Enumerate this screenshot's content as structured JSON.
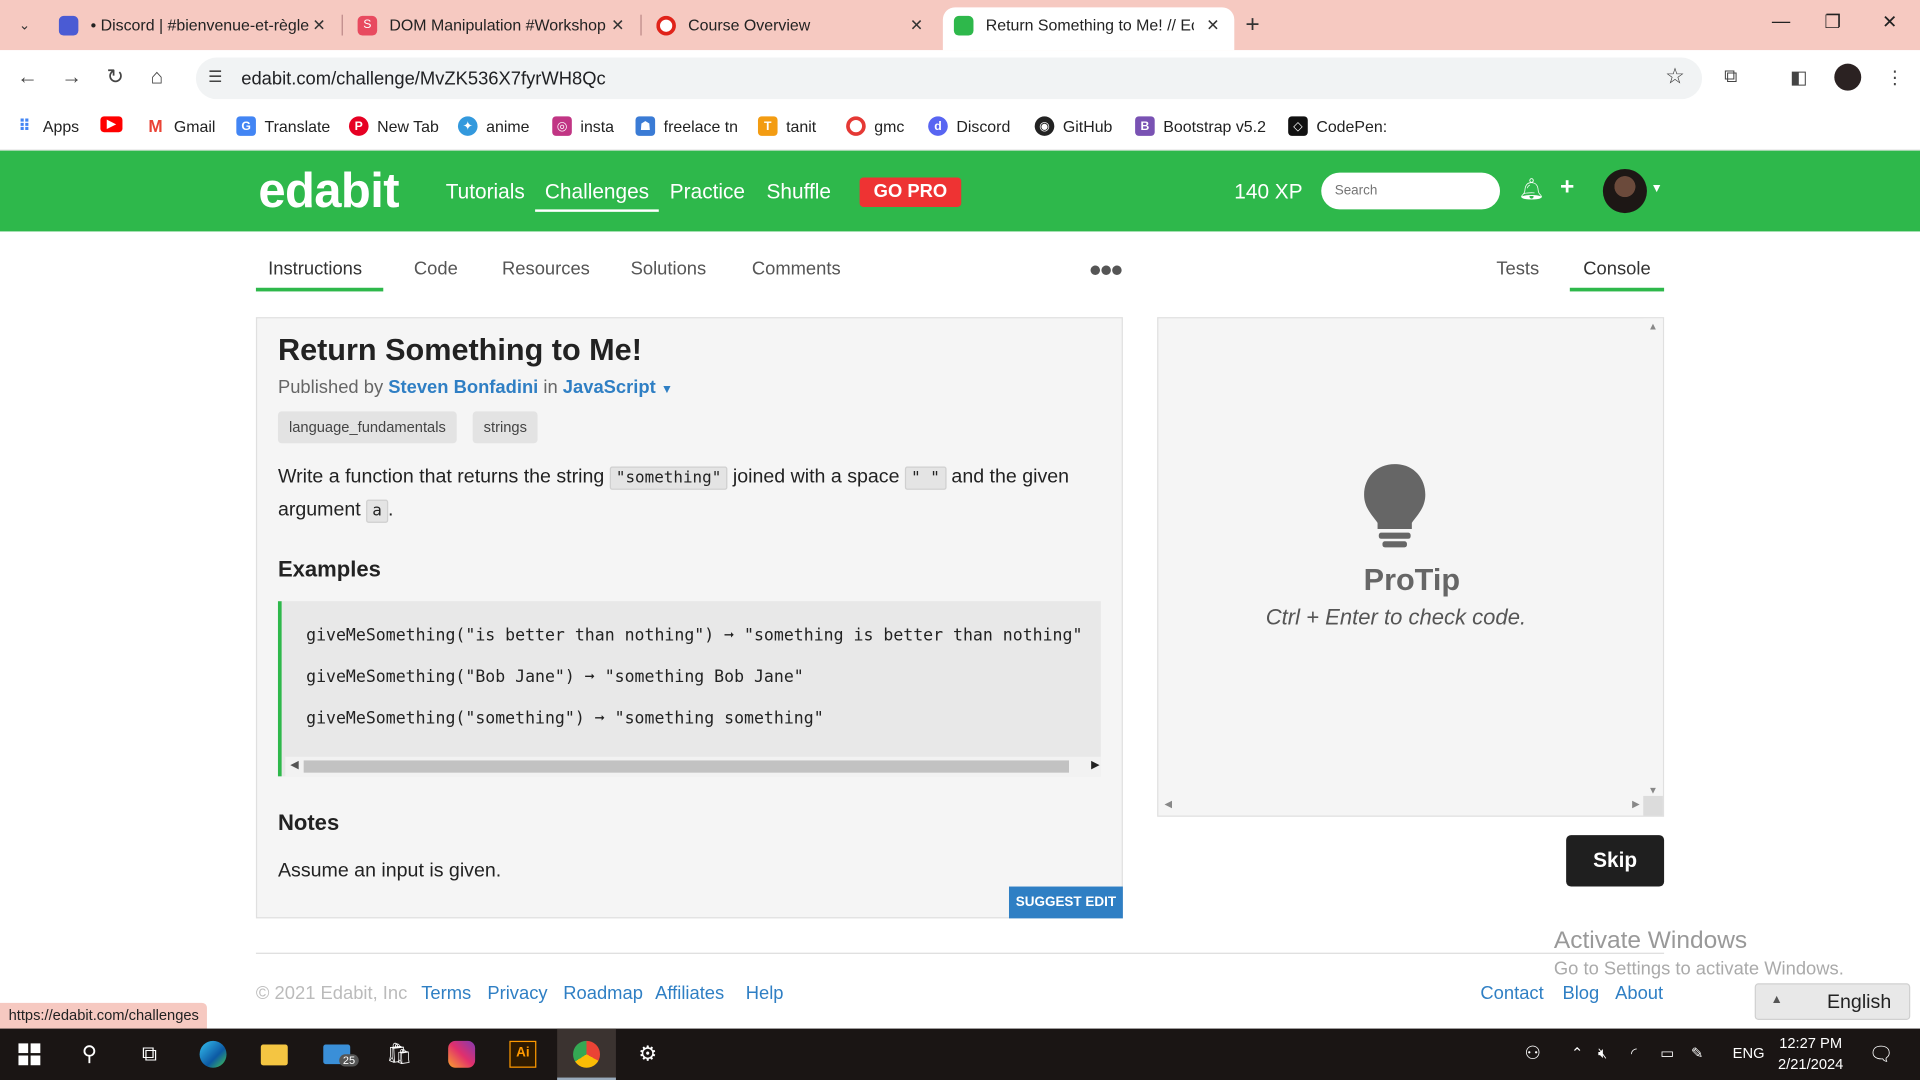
{
  "browser": {
    "tabs": [
      {
        "title": "• Discord | #bienvenue-et-règle",
        "favicon_color": "#5865f2"
      },
      {
        "title": "DOM Manipulation #Workshop",
        "favicon_color": "#e84a5f"
      },
      {
        "title": "Course Overview",
        "favicon_color": "#e0231a"
      },
      {
        "title": "Return Something to Me! // Edabit",
        "favicon_color": "#2eb84b"
      }
    ],
    "url": "edabit.com/challenge/MvZK536X7fyrWH8Qc",
    "bookmarks": [
      {
        "label": "Apps",
        "color": "#4285f4"
      },
      {
        "label": "",
        "color": "#ff0000"
      },
      {
        "label": "Gmail",
        "color": "#ea4335"
      },
      {
        "label": "Translate",
        "color": "#4285f4"
      },
      {
        "label": "New Tab",
        "color": "#e60023"
      },
      {
        "label": "anime",
        "color": "#3399dd"
      },
      {
        "label": "insta",
        "color": "#c13584"
      },
      {
        "label": "freelace tn",
        "color": "#3a7bd5"
      },
      {
        "label": "tanit",
        "color": "#f39c12"
      },
      {
        "label": "gmc",
        "color": "#e53935"
      },
      {
        "label": "Discord",
        "color": "#5865f2"
      },
      {
        "label": "GitHub",
        "color": "#222222"
      },
      {
        "label": "Bootstrap v5.2",
        "color": "#7952b3"
      },
      {
        "label": "CodePen:",
        "color": "#111111"
      }
    ],
    "status_url": "https://edabit.com/challenges"
  },
  "header": {
    "logo": "edabit",
    "nav": [
      "Tutorials",
      "Challenges",
      "Practice",
      "Shuffle"
    ],
    "gopro": "GO PRO",
    "xp": "140 XP",
    "search_placeholder": "Search"
  },
  "subtabs": {
    "left": [
      "Instructions",
      "Code",
      "Resources",
      "Solutions",
      "Comments"
    ],
    "right": [
      "Tests",
      "Console"
    ]
  },
  "challenge": {
    "title": "Return Something to Me!",
    "published_by": "Published by",
    "author": "Steven Bonfadini",
    "in": "in",
    "language": "JavaScript",
    "tags": [
      "language_fundamentals",
      "strings"
    ],
    "desc_1": "Write a function that returns the string",
    "code_1": "\"something\"",
    "desc_2": "joined with a space",
    "code_2": "\" \"",
    "desc_3": "and the given argument",
    "code_3": "a",
    "desc_4": ".",
    "examples_heading": "Examples",
    "examples": [
      "giveMeSomething(\"is better than nothing\") ➞ \"something is better than nothing\"",
      "giveMeSomething(\"Bob Jane\") ➞ \"something Bob Jane\"",
      "giveMeSomething(\"something\") ➞ \"something something\""
    ],
    "notes_heading": "Notes",
    "notes": "Assume an input is given.",
    "suggest_edit": "SUGGEST EDIT"
  },
  "console": {
    "protip": "ProTip",
    "protip_text": "Ctrl + Enter to check code.",
    "skip": "Skip"
  },
  "footer": {
    "copyright": "© 2021 Edabit, Inc",
    "links_left": [
      "Terms",
      "Privacy",
      "Roadmap",
      "Affiliates",
      "Help"
    ],
    "links_right": [
      "Contact",
      "Blog",
      "About"
    ],
    "language": "English",
    "activate_title": "Activate Windows",
    "activate_text": "Go to Settings to activate Windows."
  },
  "taskbar": {
    "lang": "ENG",
    "time": "12:27 PM",
    "date": "2/21/2024",
    "mail_badge": "25"
  }
}
